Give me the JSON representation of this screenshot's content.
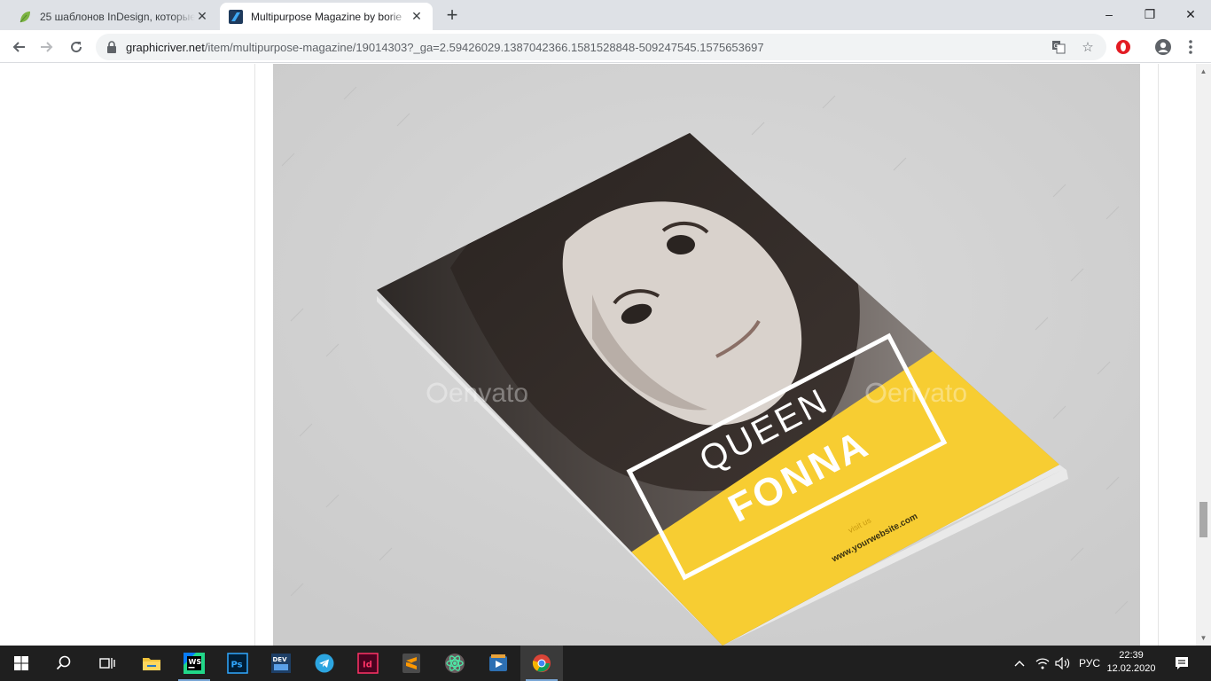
{
  "browser": {
    "tabs": [
      {
        "title": "25 шаблонов InDesign, которые",
        "close": "✕"
      },
      {
        "title": "Multipurpose Magazine by borie",
        "close": "✕"
      }
    ],
    "new_tab": "+",
    "window_controls": {
      "minimize": "–",
      "maximize": "❐",
      "close": "✕"
    },
    "url_host": "graphicriver.net",
    "url_path": "/item/multipurpose-magazine/19014303?_ga=2.59426029.1387042366.1581528848-509247545.1575653697"
  },
  "preview": {
    "watermark_left": "envato",
    "watermark_right": "envato",
    "cover": {
      "title_line1": "QUEEN",
      "title_line2": "FONNA",
      "visit": "visit us",
      "website": "www.yourwebsite.com"
    }
  },
  "taskbar": {
    "apps": [
      "windows-start",
      "search",
      "task-view",
      "file-explorer",
      "webstorm",
      "photoshop",
      "devexpress",
      "telegram",
      "indesign",
      "sublime-text",
      "atom",
      "media-player",
      "chrome"
    ],
    "tray": {
      "language": "РУС"
    },
    "clock": {
      "time": "22:39",
      "date": "12.02.2020"
    }
  },
  "colors": {
    "accent_yellow": "#f7cd32",
    "preview_bg": "#d3d3d3",
    "taskbar": "#1f1f1f",
    "tabstrip": "#dee1e6"
  }
}
